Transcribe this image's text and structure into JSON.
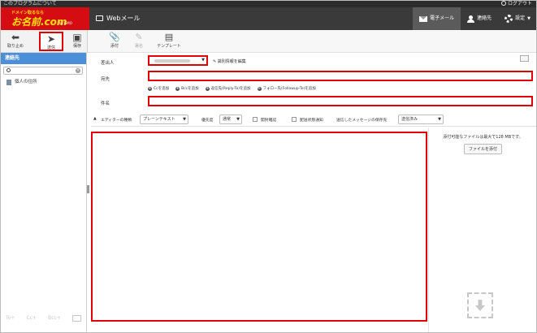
{
  "topbar": {
    "about": "このプログラムについて",
    "logout": "ログアウト"
  },
  "logo": {
    "tagline": "ドメイン取るなら",
    "name": "お名前.com",
    "sub": "by GMO"
  },
  "header": {
    "app_name": "Webメール",
    "nav": [
      {
        "label": "電子メール",
        "icon": "envelope-icon",
        "active": true
      },
      {
        "label": "連絡先",
        "icon": "person-icon"
      },
      {
        "label": "設定",
        "icon": "gear-icon"
      }
    ]
  },
  "toolbar_left": {
    "cancel": "取り止め",
    "send": "送信",
    "save": "保存"
  },
  "toolbar_right": {
    "attach": "添付",
    "sign": "署名",
    "template": "テンプレート"
  },
  "sidebar": {
    "title": "連絡先",
    "search_placeholder": "",
    "items": [
      {
        "label": "個人の住所"
      }
    ],
    "bottom": [
      "To+",
      "Cc+",
      "Bcc+"
    ]
  },
  "compose": {
    "from_label": "差出人",
    "edit_identity": "識別情報を編集",
    "to_label": "宛先",
    "add_links": [
      "Ccを追加",
      "Bccを追加",
      "返信先(Reply-To)を追加",
      "フォロー先(Followup-To)を追加"
    ],
    "subject_label": "件名",
    "to_value": "",
    "subject_value": ""
  },
  "options": {
    "editor_label": "エディターの種類",
    "editor_value": "プレーンテキスト",
    "priority_label": "優先度",
    "priority_value": "通常",
    "read_receipt": "開封確認",
    "delivery_status": "配送状態通知",
    "save_sent_label": "送信したメッセージの保存先",
    "save_sent_value": "送信済み"
  },
  "attachments": {
    "max_text": "添付可能なファイルは最大で128 MBです。",
    "attach_button": "ファイルを添付"
  },
  "colors": {
    "brand": "#d50d12",
    "header": "#3a3a3a",
    "sidebar_title": "#4a8fd8",
    "highlight": "#e00000"
  }
}
